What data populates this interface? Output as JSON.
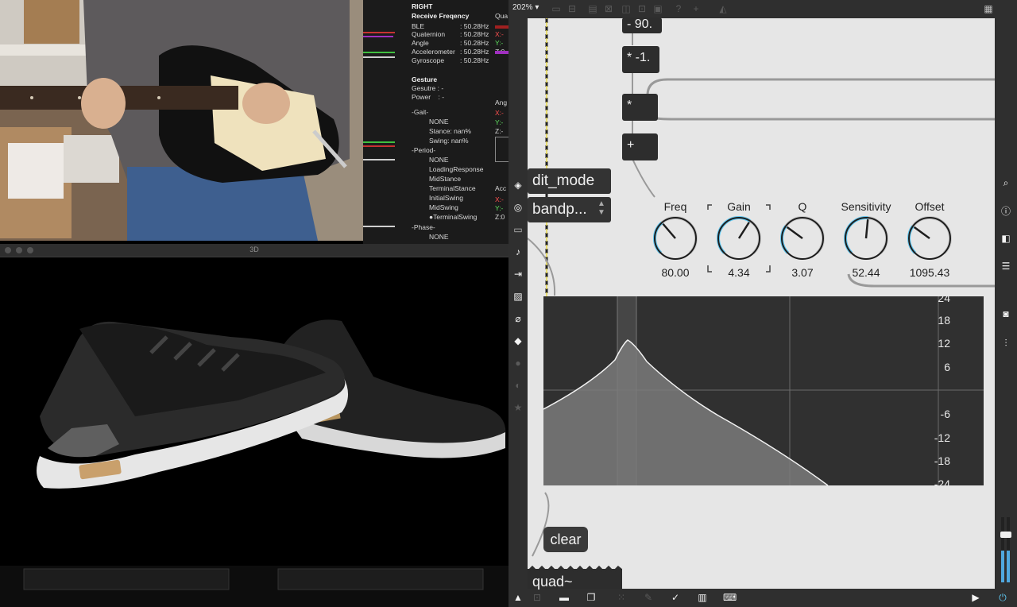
{
  "sensor_panel": {
    "side": "RIGHT",
    "receive_title": "Receive Freqency",
    "rates": [
      {
        "name": "BLE",
        "value": ": 50.28Hz"
      },
      {
        "name": "Quaternion",
        "value": ": 50.28Hz"
      },
      {
        "name": "Angle",
        "value": ": 50.28Hz"
      },
      {
        "name": "Accelerometer",
        "value": ": 50.28Hz"
      },
      {
        "name": "Gyroscope",
        "value": ": 50.28Hz"
      }
    ],
    "gesture_title": "Gesture",
    "gesture_rows": [
      "Gesutre : -",
      "Power    : -"
    ],
    "gait_title": "-Gait-",
    "gait_rows": [
      "NONE",
      "Stance: nan%",
      "Swing: nan%"
    ],
    "period_title": "-Period-",
    "period_rows": [
      "NONE",
      "LoadingResponse",
      "MidStance",
      "TerminalStance",
      "InitialSwing",
      "MidSwing",
      "●TerminalSwing"
    ],
    "phase_title": "-Phase-",
    "phase_rows": [
      "NONE"
    ],
    "side_labels": [
      "Qua",
      "X:-",
      "Y:-",
      "Z:0",
      "Ang",
      "X:-",
      "Y:-",
      "Z:-",
      "Acc",
      "X:-",
      "Y:-",
      "Z:0"
    ]
  },
  "three_window": {
    "title": "3D"
  },
  "max_patch": {
    "zoom": "202%",
    "objects": {
      "sub": "- 90.",
      "mul_neg": "* -1.",
      "mul": "*",
      "add": "+",
      "edit_mode": "dit_mode",
      "filter_type": "bandp...",
      "clear": "clear",
      "biquad": "quad~"
    },
    "dials": [
      {
        "label": "Freq",
        "value": "80.00",
        "level": 0.35
      },
      {
        "label": "Gain",
        "value": "4.34",
        "level": 0.62
      },
      {
        "label": "Q",
        "value": "3.07",
        "level": 0.3
      },
      {
        "label": "Sensitivity",
        "value": "52.44",
        "level": 0.52
      },
      {
        "label": "Offset",
        "value": "1095.43",
        "level": 0.3
      }
    ],
    "filter_graph": {
      "y_ticks": [
        "24",
        "18",
        "12",
        "6",
        "-6",
        "-12",
        "-18",
        "-24"
      ]
    }
  },
  "colors": {
    "accent_blue": "#5ec8f2",
    "patch_bg": "#e6e6e6",
    "object_bg": "#2d2d2d",
    "toolbar_bg": "#2f2f2f"
  }
}
